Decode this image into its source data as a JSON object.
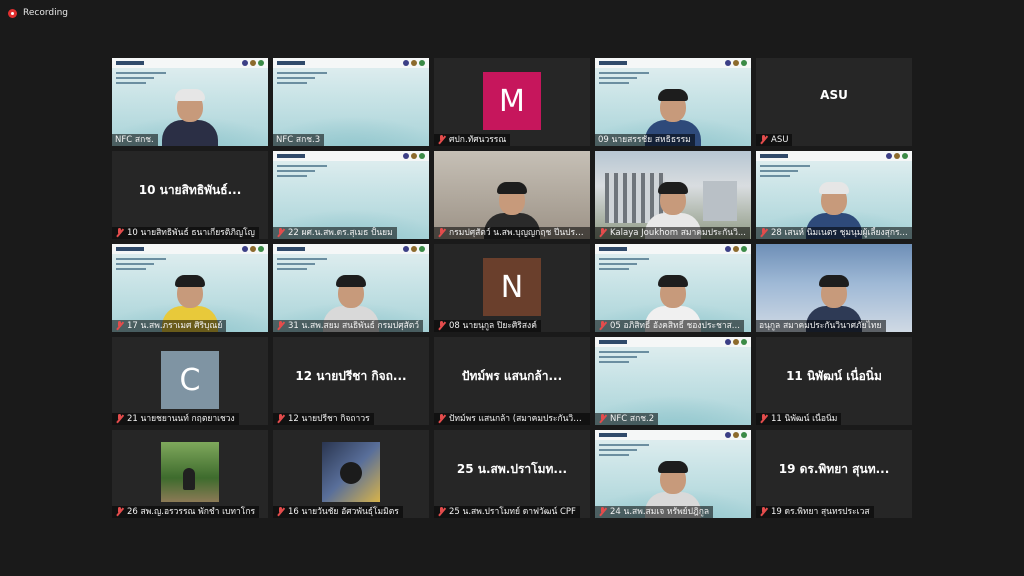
{
  "recording": {
    "label": "Recording",
    "color": "#e02f2f"
  },
  "tiles": [
    {
      "label": "NFC สกช.",
      "kind": "slide-person",
      "muted": false
    },
    {
      "label": "NFC สกช.3",
      "kind": "slide",
      "muted": false
    },
    {
      "label": "ศปก.ทัศนวรรณ",
      "kind": "initial",
      "initial": "M",
      "color": "#c6165c",
      "muted": true
    },
    {
      "label": "09 นายสรรชัย สหธิธรรม",
      "kind": "slide-person",
      "muted": false,
      "active": true
    },
    {
      "label": "ASU",
      "kind": "name",
      "big": "ASU",
      "muted": true
    },
    {
      "label": "10 นายสิทธิพันธ์ ธนาเกียรติภิญโญ",
      "kind": "name",
      "big": "10 นายสิทธิพันธ์...",
      "muted": true
    },
    {
      "label": "22 ผศ.น.สพ.ดร.สุเมธ ปั้นยม",
      "kind": "slide",
      "muted": true
    },
    {
      "label": "กรมปศุสัตว์ น.สพ.บุญญกฤช ปีนประ...",
      "kind": "room-person",
      "muted": true
    },
    {
      "label": "Kalaya Joukhom สมาคมประกันวิ...",
      "kind": "building-person",
      "muted": true
    },
    {
      "label": "28 เสนห์ นิมเนตร ชุมนุมผู้เลี้ยงสุกร...",
      "kind": "slide-person",
      "muted": true
    },
    {
      "label": "17 น.สพ.ภราเมศ ศิริบุณย์",
      "kind": "slide-person",
      "muted": true
    },
    {
      "label": "31 น.สพ.สยม สนธิพันธ์ กรมปศุสัตว์",
      "kind": "slide-person",
      "muted": true
    },
    {
      "label": "08 นายนุกูล ปิยะศิริสงค์",
      "kind": "initial",
      "initial": "N",
      "color": "#6a3f2c",
      "muted": true
    },
    {
      "label": "05 อภิสิทธิ์ อังคสิทธิ์ ชองประชาส...",
      "kind": "slide-person",
      "muted": true
    },
    {
      "label": "อนุกูล สมาคมประกันวินาศภัยไทย",
      "kind": "sky-person",
      "muted": false
    },
    {
      "label": "21 นายชยานนท์ กฤตยาเชวง",
      "kind": "initial",
      "initial": "C",
      "color": "#7f94a3",
      "muted": true
    },
    {
      "label": "12 นายปรีชา กิจถาวร",
      "kind": "name",
      "big": "12 นายปรีชา กิจถ...",
      "muted": true
    },
    {
      "label": "ปัทม์พร แสนกล้า (สมาคมประกันวิน...",
      "kind": "name",
      "big": "ปัทม์พร แสนกล้า...",
      "muted": true
    },
    {
      "label": "NFC สกช.2",
      "kind": "slide",
      "muted": true
    },
    {
      "label": "11 นิพัฒน์ เนื่อนิ่ม",
      "kind": "name",
      "big": "11 นิพัฒน์ เนื่อนิ่ม",
      "muted": true
    },
    {
      "label": "26 สพ.ญ.อรวรรณ พักชำ เบทาโกร",
      "kind": "thumb-garden",
      "muted": true
    },
    {
      "label": "16 นายวันชัย อัศวพันธุ์โมมิตร",
      "kind": "thumb-photo",
      "muted": true
    },
    {
      "label": "25 น.สพ.ปราโมทย์ ดาฟวัฒน์ CPF",
      "kind": "name",
      "big": "25 น.สพ.ปราโมท...",
      "muted": true
    },
    {
      "label": "24 น.สพ.สมเจ หรัพย์ปฎิกูล",
      "kind": "slide-person",
      "muted": true
    },
    {
      "label": "19 ดร.พิทยา สุนทรประเวส",
      "kind": "name",
      "big": "19 ดร.พิทยา สุนท...",
      "muted": true
    }
  ]
}
